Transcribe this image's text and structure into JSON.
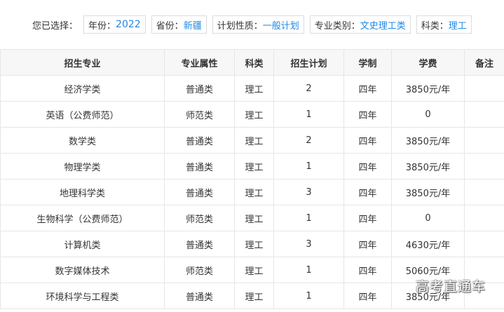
{
  "filters": {
    "prefix": "您已选择：",
    "items": [
      {
        "key": "年份：",
        "value": "2022"
      },
      {
        "key": "省份：",
        "value": "新疆"
      },
      {
        "key": "计划性质：",
        "value": "一般计划"
      },
      {
        "key": "专业类别：",
        "value": "文史理工类"
      },
      {
        "key": "科类：",
        "value": "理工"
      }
    ]
  },
  "table": {
    "headers": [
      "招生专业",
      "专业属性",
      "科类",
      "招生计划",
      "学制",
      "学费",
      "备注"
    ],
    "rows": [
      [
        "经济学类",
        "普通类",
        "理工",
        "2",
        "四年",
        "3850元/年",
        ""
      ],
      [
        "英语（公费师范）",
        "师范类",
        "理工",
        "1",
        "四年",
        "0",
        ""
      ],
      [
        "数学类",
        "普通类",
        "理工",
        "2",
        "四年",
        "3850元/年",
        ""
      ],
      [
        "物理学类",
        "普通类",
        "理工",
        "1",
        "四年",
        "3850元/年",
        ""
      ],
      [
        "地理科学类",
        "普通类",
        "理工",
        "3",
        "四年",
        "3850元/年",
        ""
      ],
      [
        "生物科学（公费师范）",
        "师范类",
        "理工",
        "1",
        "四年",
        "0",
        ""
      ],
      [
        "计算机类",
        "普通类",
        "理工",
        "3",
        "四年",
        "4630元/年",
        ""
      ],
      [
        "数字媒体技术",
        "师范类",
        "理工",
        "1",
        "四年",
        "5060元/年",
        ""
      ],
      [
        "环境科学与工程类",
        "普通类",
        "理工",
        "1",
        "四年",
        "3850元/年",
        ""
      ]
    ]
  },
  "watermark": "高考直通车"
}
